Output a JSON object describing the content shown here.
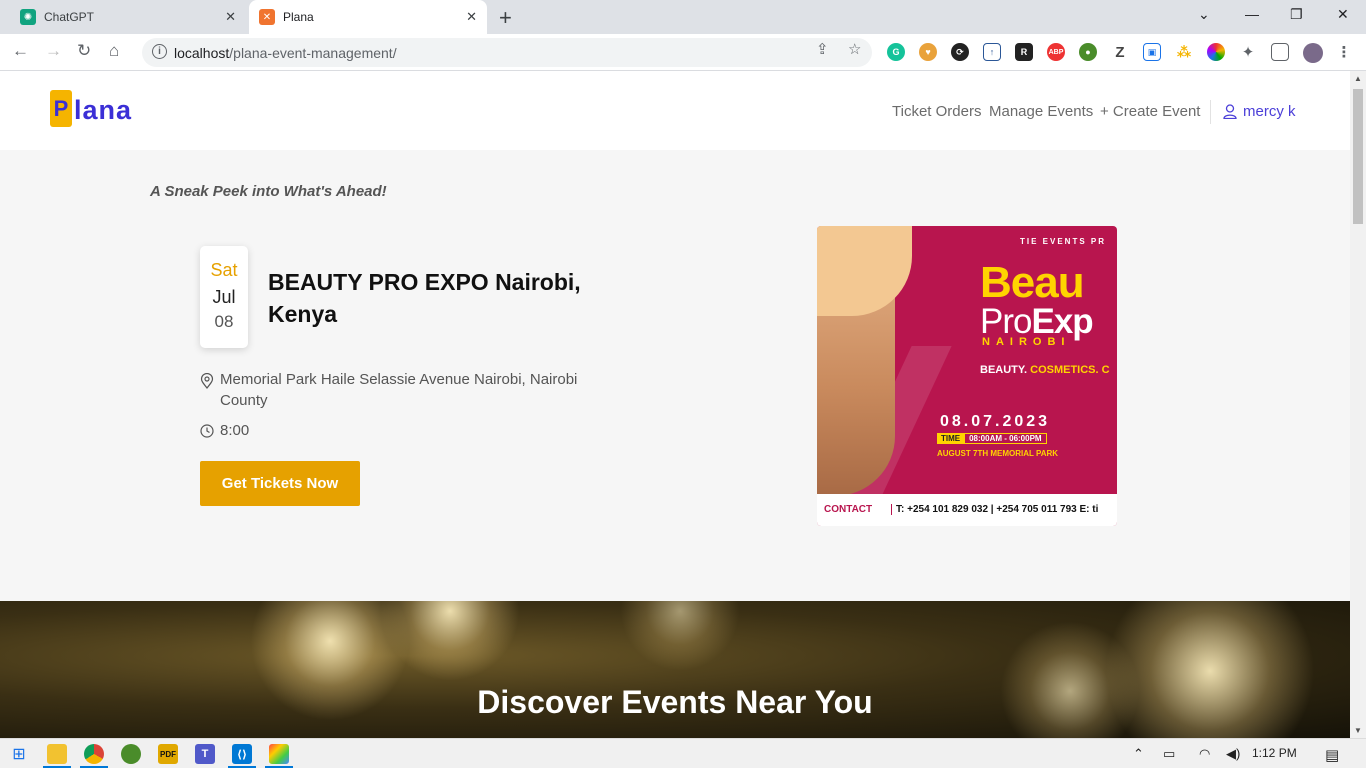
{
  "browser": {
    "tabs": [
      {
        "label": "ChatGPT",
        "active": false
      },
      {
        "label": "Plana",
        "active": true
      }
    ],
    "url_host": "localhost",
    "url_path": "/plana-event-management/",
    "extensions": [
      "grammarly-icon",
      "heart-extension-icon",
      "sync-icon",
      "upload-icon",
      "r-extension-icon",
      "adblock-icon",
      "globe-extension-icon",
      "z-extension-icon",
      "screen-recorder-icon",
      "dots-extension-icon",
      "color-wheel-icon",
      "puzzle-icon",
      "sidebar-icon",
      "profile-avatar"
    ]
  },
  "header": {
    "logo_mark": "P",
    "logo_text": "lana",
    "nav": {
      "ticket_orders": "Ticket Orders",
      "manage_events": "Manage Events",
      "create_event": "+ Create Event"
    },
    "user_name": "mercy k"
  },
  "main": {
    "tagline": "A Sneak Peek into What's Ahead!",
    "event": {
      "day_name": "Sat",
      "month": "Jul",
      "day": "08",
      "title": "BEAUTY PRO EXPO Nairobi, Kenya",
      "location": "Memorial Park Haile Selassie Avenue Nairobi, Nairobi County",
      "time": "8:00",
      "cta": "Get Tickets Now"
    },
    "poster": {
      "presenter": "TIE EVENTS PR",
      "title_line1": "Beau",
      "title_line2_a": "Pro",
      "title_line2_b": "Exp",
      "city": "NAIROBI",
      "tagline_a": "BEAUTY.",
      "tagline_b": "COSMETICS. C",
      "date": "08.07.2023",
      "time_label": "TIME",
      "time_value": "08:00AM - 06:00PM",
      "venue": "AUGUST 7TH MEMORIAL PARK",
      "contact_label": "CONTACT",
      "phones": "T: +254 101 829 032 | +254 705 011 793  E: ti"
    },
    "hero_title": "Discover Events Near You"
  },
  "taskbar": {
    "clock": "1:12 PM"
  },
  "colors": {
    "brand_purple": "#3b2fd6",
    "brand_yellow": "#f5b400",
    "cta": "#e6a100",
    "poster_bg": "#b8154e"
  }
}
